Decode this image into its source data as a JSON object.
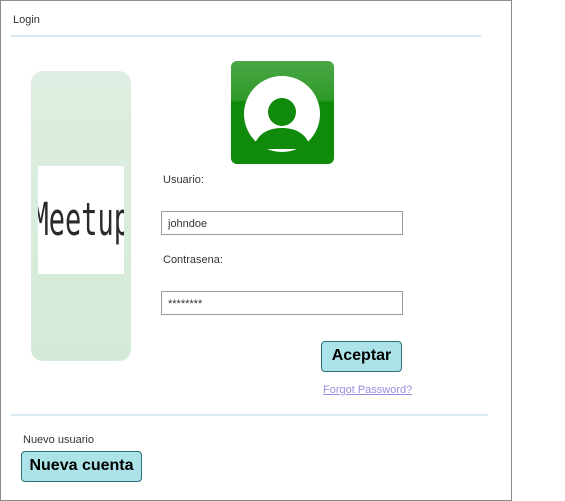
{
  "window": {
    "title": "Login"
  },
  "form": {
    "user_label": "Usuario:",
    "user_value": "johndoe",
    "password_label": "Contrasena:",
    "password_value": "********",
    "accept_label": "Aceptar",
    "forgot_label": "Forgot Password?"
  },
  "logo": {
    "text": "Meetup"
  },
  "avatar": {
    "icon": "user-avatar-icon"
  },
  "new_user": {
    "label": "Nuevo usuario",
    "button_label": "Nueva cuenta"
  },
  "colors": {
    "accent_button": "#ace3e8",
    "avatar_green": "#0f8a0a",
    "link": "#9b8de0",
    "panel": "#d9ecdd"
  }
}
